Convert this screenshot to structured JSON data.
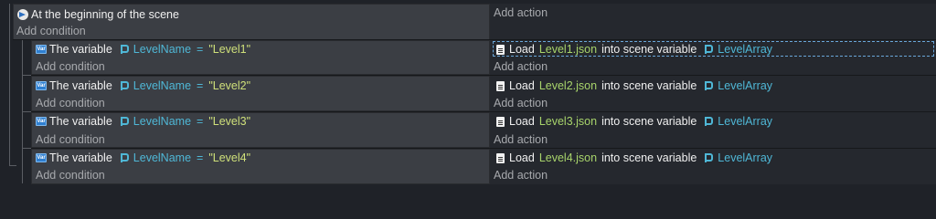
{
  "root_event": {
    "condition": "At the beginning of the scene",
    "add_condition": "Add condition",
    "add_action": "Add action",
    "icon": "scene-start-icon"
  },
  "sub_events": [
    {
      "cond_prefix": "The variable",
      "var_name": "LevelName",
      "operator": "=",
      "value": "\"Level1\"",
      "add_condition": "Add condition",
      "action_verb": "Load",
      "file": "Level1.json",
      "action_mid": "into scene variable",
      "target_var": "LevelArray",
      "add_action": "Add action"
    },
    {
      "cond_prefix": "The variable",
      "var_name": "LevelName",
      "operator": "=",
      "value": "\"Level2\"",
      "add_condition": "Add condition",
      "action_verb": "Load",
      "file": "Level2.json",
      "action_mid": "into scene variable",
      "target_var": "LevelArray",
      "add_action": "Add action"
    },
    {
      "cond_prefix": "The variable",
      "var_name": "LevelName",
      "operator": "=",
      "value": "\"Level3\"",
      "add_condition": "Add condition",
      "action_verb": "Load",
      "file": "Level3.json",
      "action_mid": "into scene variable",
      "target_var": "LevelArray",
      "add_action": "Add action"
    },
    {
      "cond_prefix": "The variable",
      "var_name": "LevelName",
      "operator": "=",
      "value": "\"Level4\"",
      "add_condition": "Add condition",
      "action_verb": "Load",
      "file": "Level4.json",
      "action_mid": "into scene variable",
      "target_var": "LevelArray",
      "add_action": "Add action"
    }
  ],
  "colors": {
    "variable_name": "#4fb7d6",
    "string_value": "#cfe07a",
    "file_name": "#a8d46b",
    "condition_bg": "#3b3e44",
    "action_bg": "#25282e"
  },
  "icons": {
    "variable_condition": "variable-icon",
    "scene_variable": "scene-variable-icon",
    "load_file": "file-icon"
  },
  "icon_text": {
    "variable_badge": "Var"
  }
}
